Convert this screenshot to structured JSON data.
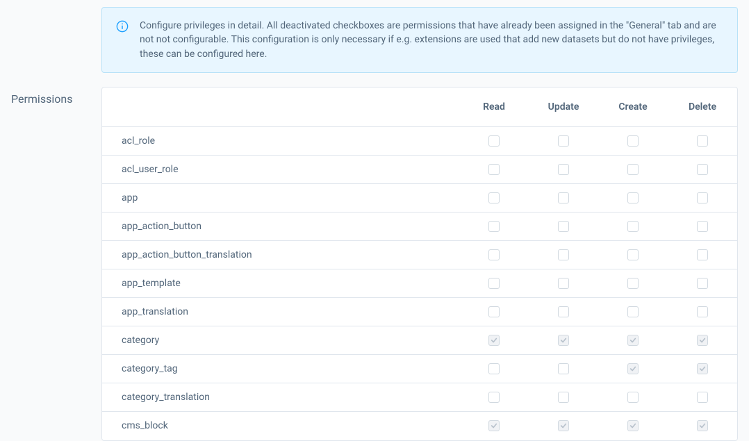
{
  "info": {
    "text": "Configure privileges in detail. All deactivated checkboxes are permissions that have already been assigned in the \"General\" tab and are not not configurable. This configuration is only necessary if e.g. extensions are used that add new datasets but do not have privileges, these can be configured here."
  },
  "section_title": "Permissions",
  "columns": {
    "read": "Read",
    "update": "Update",
    "create": "Create",
    "delete": "Delete"
  },
  "rows": [
    {
      "name": "acl_role",
      "read": {
        "checked": false,
        "disabled": false
      },
      "update": {
        "checked": false,
        "disabled": false
      },
      "create": {
        "checked": false,
        "disabled": false
      },
      "delete": {
        "checked": false,
        "disabled": false
      }
    },
    {
      "name": "acl_user_role",
      "read": {
        "checked": false,
        "disabled": false
      },
      "update": {
        "checked": false,
        "disabled": false
      },
      "create": {
        "checked": false,
        "disabled": false
      },
      "delete": {
        "checked": false,
        "disabled": false
      }
    },
    {
      "name": "app",
      "read": {
        "checked": false,
        "disabled": false
      },
      "update": {
        "checked": false,
        "disabled": false
      },
      "create": {
        "checked": false,
        "disabled": false
      },
      "delete": {
        "checked": false,
        "disabled": false
      }
    },
    {
      "name": "app_action_button",
      "read": {
        "checked": false,
        "disabled": false
      },
      "update": {
        "checked": false,
        "disabled": false
      },
      "create": {
        "checked": false,
        "disabled": false
      },
      "delete": {
        "checked": false,
        "disabled": false
      }
    },
    {
      "name": "app_action_button_translation",
      "read": {
        "checked": false,
        "disabled": false
      },
      "update": {
        "checked": false,
        "disabled": false
      },
      "create": {
        "checked": false,
        "disabled": false
      },
      "delete": {
        "checked": false,
        "disabled": false
      }
    },
    {
      "name": "app_template",
      "read": {
        "checked": false,
        "disabled": false
      },
      "update": {
        "checked": false,
        "disabled": false
      },
      "create": {
        "checked": false,
        "disabled": false
      },
      "delete": {
        "checked": false,
        "disabled": false
      }
    },
    {
      "name": "app_translation",
      "read": {
        "checked": false,
        "disabled": false
      },
      "update": {
        "checked": false,
        "disabled": false
      },
      "create": {
        "checked": false,
        "disabled": false
      },
      "delete": {
        "checked": false,
        "disabled": false
      }
    },
    {
      "name": "category",
      "read": {
        "checked": true,
        "disabled": true
      },
      "update": {
        "checked": true,
        "disabled": true
      },
      "create": {
        "checked": true,
        "disabled": true
      },
      "delete": {
        "checked": true,
        "disabled": true
      }
    },
    {
      "name": "category_tag",
      "read": {
        "checked": false,
        "disabled": false
      },
      "update": {
        "checked": false,
        "disabled": false
      },
      "create": {
        "checked": true,
        "disabled": true
      },
      "delete": {
        "checked": true,
        "disabled": true
      }
    },
    {
      "name": "category_translation",
      "read": {
        "checked": false,
        "disabled": false
      },
      "update": {
        "checked": false,
        "disabled": false
      },
      "create": {
        "checked": false,
        "disabled": false
      },
      "delete": {
        "checked": false,
        "disabled": false
      }
    },
    {
      "name": "cms_block",
      "read": {
        "checked": true,
        "disabled": true
      },
      "update": {
        "checked": true,
        "disabled": true
      },
      "create": {
        "checked": true,
        "disabled": true
      },
      "delete": {
        "checked": true,
        "disabled": true
      }
    }
  ]
}
